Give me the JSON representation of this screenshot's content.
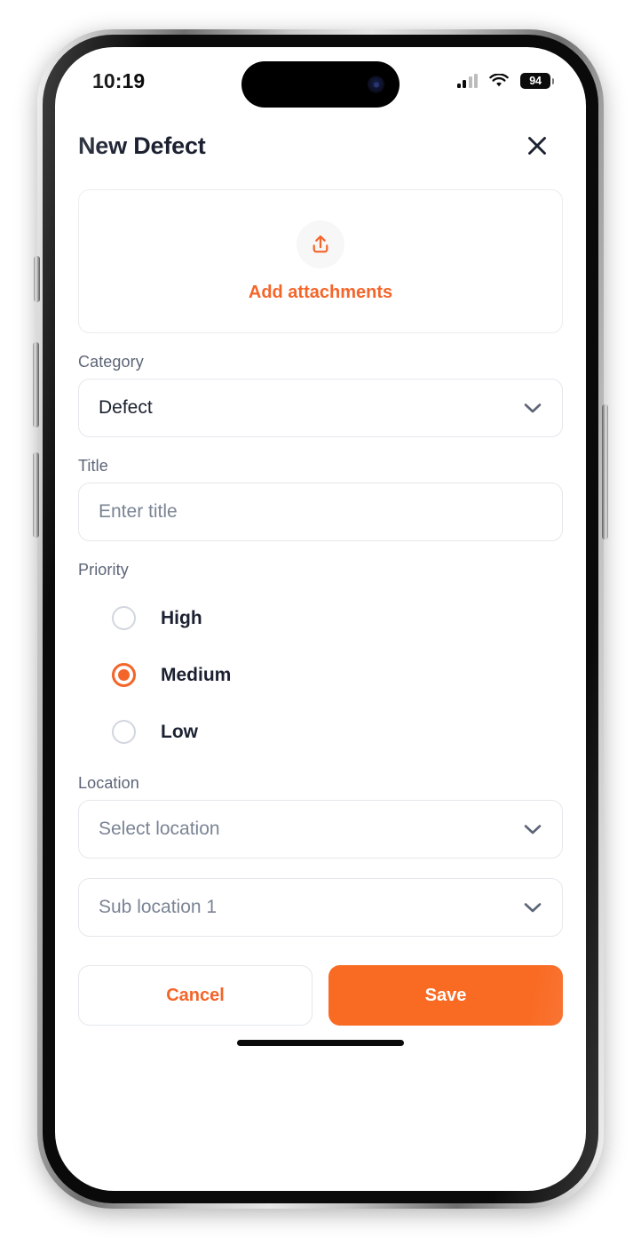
{
  "status_bar": {
    "time": "10:19",
    "battery_percent": "94",
    "signal_icon": "cellular-signal-icon",
    "wifi_icon": "wifi-icon",
    "battery_icon": "battery-icon"
  },
  "header": {
    "title": "New Defect",
    "close_icon": "close-icon"
  },
  "attachments": {
    "upload_icon": "upload-icon",
    "label": "Add attachments"
  },
  "fields": {
    "category": {
      "label": "Category",
      "value": "Defect",
      "is_placeholder": false,
      "chevron_icon": "chevron-down-icon"
    },
    "title": {
      "label": "Title",
      "value": "",
      "placeholder": "Enter title"
    },
    "location": {
      "label": "Location",
      "value": "Select location",
      "is_placeholder": true,
      "chevron_icon": "chevron-down-icon"
    },
    "sub_location": {
      "label": "",
      "value": "Sub location 1",
      "is_placeholder": true,
      "chevron_icon": "chevron-down-icon"
    }
  },
  "priority": {
    "label": "Priority",
    "selected": "Medium",
    "options": [
      {
        "label": "High",
        "selected": false
      },
      {
        "label": "Medium",
        "selected": true
      },
      {
        "label": "Low",
        "selected": false
      }
    ]
  },
  "footer": {
    "cancel_label": "Cancel",
    "save_label": "Save"
  },
  "colors": {
    "accent_orange": "#f4652a",
    "save_orange": "#f96a23",
    "label_slate": "#5c6477",
    "text_dark": "#1b2130",
    "placeholder_gray": "#7b8494",
    "border_gray": "#e5e7ec"
  }
}
